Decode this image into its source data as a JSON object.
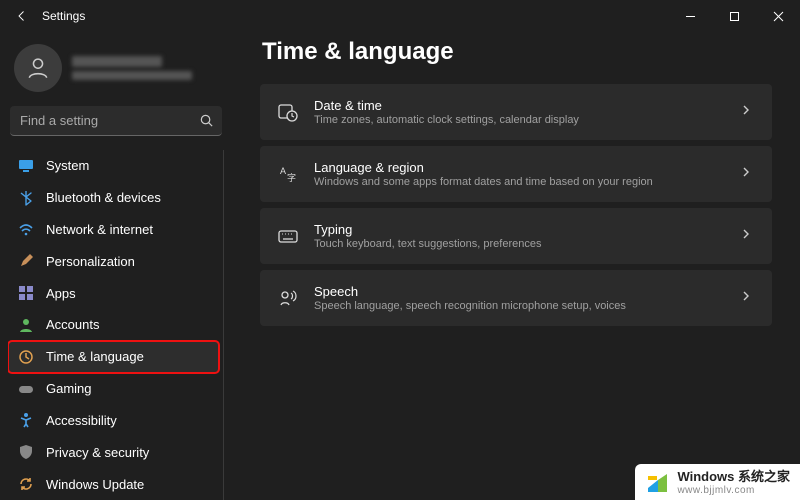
{
  "window": {
    "app_title": "Settings"
  },
  "profile": {
    "name_redacted": true
  },
  "search": {
    "placeholder": "Find a setting"
  },
  "sidebar": {
    "items": [
      {
        "icon": "system",
        "label": "System"
      },
      {
        "icon": "bluetooth",
        "label": "Bluetooth & devices"
      },
      {
        "icon": "wifi",
        "label": "Network & internet"
      },
      {
        "icon": "brush",
        "label": "Personalization"
      },
      {
        "icon": "apps",
        "label": "Apps"
      },
      {
        "icon": "account",
        "label": "Accounts"
      },
      {
        "icon": "globe",
        "label": "Time & language",
        "selected": true,
        "highlighted": true
      },
      {
        "icon": "game",
        "label": "Gaming"
      },
      {
        "icon": "access",
        "label": "Accessibility"
      },
      {
        "icon": "shield",
        "label": "Privacy & security"
      },
      {
        "icon": "update",
        "label": "Windows Update"
      }
    ]
  },
  "main": {
    "title": "Time & language",
    "cards": [
      {
        "icon": "clock",
        "title": "Date & time",
        "sub": "Time zones, automatic clock settings, calendar display"
      },
      {
        "icon": "lang",
        "title": "Language & region",
        "sub": "Windows and some apps format dates and time based on your region"
      },
      {
        "icon": "keyboard",
        "title": "Typing",
        "sub": "Touch keyboard, text suggestions, preferences"
      },
      {
        "icon": "speech",
        "title": "Speech",
        "sub": "Speech language, speech recognition microphone setup, voices"
      }
    ]
  },
  "watermark": {
    "main": "Windows 系统之家",
    "sub": "www.bjjmlv.com"
  }
}
